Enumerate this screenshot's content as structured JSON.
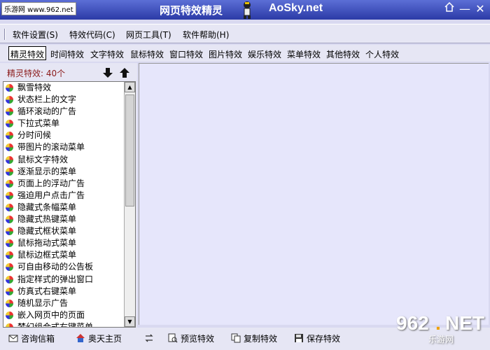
{
  "watermark_top": "乐游网 www.962.net",
  "app_title": "网页特效精灵",
  "brand": "AoSky.net",
  "menu": [
    "软件设置(S)",
    "特效代码(C)",
    "网页工具(T)",
    "软件帮助(H)"
  ],
  "tabs": [
    "精灵特效",
    "时间特效",
    "文字特效",
    "鼠标特效",
    "窗口特效",
    "图片特效",
    "娱乐特效",
    "菜单特效",
    "其他特效",
    "个人特效"
  ],
  "active_tab": "精灵特效",
  "effects_count": "精灵特效: 40个",
  "effects": [
    "飘雪特效",
    "状态栏上的文字",
    "循环滚动的广告",
    "下拉式菜单",
    "分时问候",
    "带图片的滚动菜单",
    "鼠标文字特效",
    "逐渐显示的菜单",
    "页面上的浮动广告",
    "强迫用户点击广告",
    "隐藏式条幅菜单",
    "隐藏式热键菜单",
    "隐藏式框状菜单",
    "鼠标拖动式菜单",
    "鼠标边框式菜单",
    "可自由移动的公告板",
    "指定样式的弹出窗口",
    "仿真式右键菜单",
    "随机显示广告",
    "嵌入网页中的页面",
    "梦幻组合式右键菜单"
  ],
  "bottom": {
    "consult": "咨询信箱",
    "home": "奥天主页",
    "preview": "预览特效",
    "copy": "复制特效",
    "save": "保存特效"
  },
  "watermark_bottom": {
    "num": "962",
    "dot": ".",
    "net": "NET",
    "cn": "乐游网"
  },
  "colors": {
    "titlebar": "#2b3aa6",
    "panel": "#e6e6f4",
    "preview": "#e6e6fb",
    "count_text": "#8b1a1a"
  }
}
